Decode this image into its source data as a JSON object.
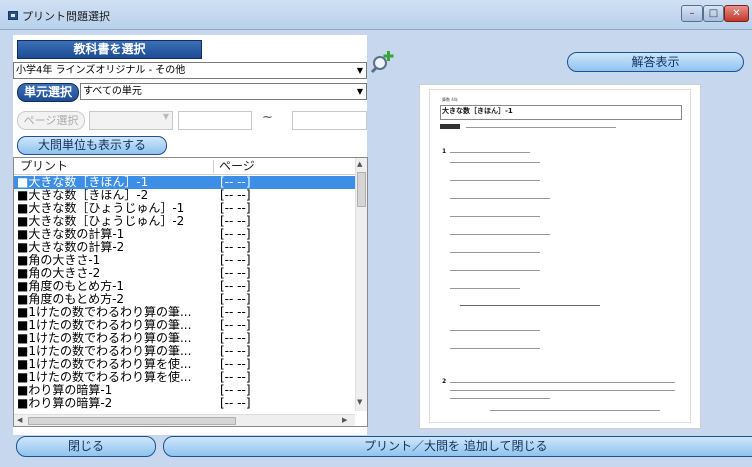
{
  "window": {
    "title": "プリント問題選択",
    "min": "–",
    "max": "□",
    "close": "✕"
  },
  "left": {
    "textbook_title": "教科書を選択",
    "textbook_value": "小学4年 ラインズオリジナル - その他",
    "unit_button": "単元選択",
    "unit_value": "すべての単元",
    "page_button": "ページ選択",
    "range_sep": "~",
    "show_daimon": "大問単位も表示する",
    "list": {
      "headers": [
        "プリント",
        "ページ"
      ],
      "rows": [
        {
          "name": "■大きな数［きほん］-1",
          "page": "[-- --]",
          "selected": true
        },
        {
          "name": "■大きな数［きほん］-2",
          "page": "[-- --]"
        },
        {
          "name": "■大きな数［ひょうじゅん］-1",
          "page": "[-- --]"
        },
        {
          "name": "■大きな数［ひょうじゅん］-2",
          "page": "[-- --]"
        },
        {
          "name": "■大きな数の計算-1",
          "page": "[-- --]"
        },
        {
          "name": "■大きな数の計算-2",
          "page": "[-- --]"
        },
        {
          "name": "■角の大きさ-1",
          "page": "[-- --]"
        },
        {
          "name": "■角の大きさ-2",
          "page": "[-- --]"
        },
        {
          "name": "■角度のもとめ方-1",
          "page": "[-- --]"
        },
        {
          "name": "■角度のもとめ方-2",
          "page": "[-- --]"
        },
        {
          "name": "■1けたの数でわるわり算の筆...",
          "page": "[-- --]"
        },
        {
          "name": "■1けたの数でわるわり算の筆...",
          "page": "[-- --]"
        },
        {
          "name": "■1けたの数でわるわり算の筆...",
          "page": "[-- --]"
        },
        {
          "name": "■1けたの数でわるわり算の筆...",
          "page": "[-- --]"
        },
        {
          "name": "■1けたの数でわるわり算を使...",
          "page": "[-- --]"
        },
        {
          "name": "■1けたの数でわるわり算を使...",
          "page": "[-- --]"
        },
        {
          "name": "■わり算の暗算-1",
          "page": "[-- --]"
        },
        {
          "name": "■わり算の暗算-2",
          "page": "[-- --]"
        }
      ]
    }
  },
  "right": {
    "answer_button": "解答表示",
    "worksheet": {
      "grade": "算数 4年",
      "title": "大きな数［きほん］-1",
      "q1": "1",
      "q2": "2"
    }
  },
  "bottom": {
    "close": "閉じる",
    "add_close": "プリント／大問を 追加して閉じる"
  },
  "colors": {
    "frame": "#c7d8ee",
    "selection": "#3d8ee6",
    "pill": "#8fc3ee",
    "pill_dark": "#1d4c94"
  }
}
